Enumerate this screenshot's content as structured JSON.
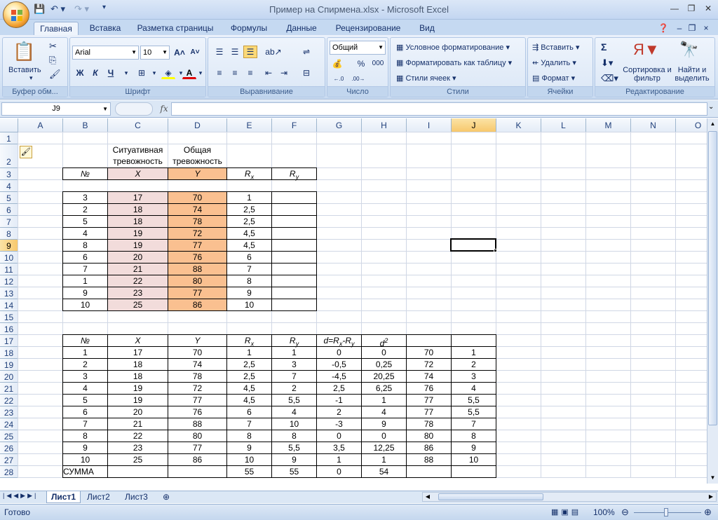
{
  "window": {
    "title": "Пример на Спирмена.xlsx - Microsoft Excel"
  },
  "ribbon": {
    "tabs": [
      "Главная",
      "Вставка",
      "Разметка страницы",
      "Формулы",
      "Данные",
      "Рецензирование",
      "Вид"
    ],
    "clipboard": {
      "paste": "Вставить",
      "label": "Буфер обм..."
    },
    "font": {
      "name": "Arial",
      "size": "10",
      "bold": "Ж",
      "italic": "К",
      "underline": "Ч",
      "label": "Шрифт"
    },
    "align": {
      "label": "Выравнивание"
    },
    "number": {
      "format": "Общий",
      "percent": "%",
      "thousands": "000",
      "label": "Число"
    },
    "styles": {
      "cond": "Условное форматирование",
      "table": "Форматировать как таблицу",
      "cell": "Стили ячеек",
      "label": "Стили"
    },
    "cells": {
      "insert": "Вставить",
      "delete": "Удалить",
      "format": "Формат",
      "label": "Ячейки"
    },
    "edit": {
      "sum": "Σ",
      "sort": "Сортировка и фильтр",
      "find": "Найти и выделить",
      "label": "Редактирование"
    }
  },
  "formula_bar": {
    "name_box": "J9",
    "fx": "fx",
    "value": ""
  },
  "grid": {
    "columns": [
      "A",
      "B",
      "C",
      "D",
      "E",
      "F",
      "G",
      "H",
      "I",
      "J",
      "K",
      "L",
      "M",
      "N",
      "O"
    ],
    "selected_col": "J",
    "selected_row": "9",
    "rows": [
      "1",
      "2",
      "3",
      "4",
      "5",
      "6",
      "7",
      "8",
      "9",
      "10",
      "11",
      "12",
      "13",
      "14",
      "15",
      "16",
      "17",
      "18",
      "19",
      "20",
      "21",
      "22",
      "23",
      "24",
      "25",
      "26",
      "27",
      "28"
    ]
  },
  "table1": {
    "header_c": "Ситуативная тревожность",
    "header_d": "Общая тревожность",
    "col_labels": {
      "b": "№",
      "c": "X",
      "d": "Y",
      "e": "R",
      "e_sub": "x",
      "f": "R",
      "f_sub": "y"
    },
    "rows": [
      [
        "3",
        "17",
        "70",
        "1"
      ],
      [
        "2",
        "18",
        "74",
        "2,5"
      ],
      [
        "5",
        "18",
        "78",
        "2,5"
      ],
      [
        "4",
        "19",
        "72",
        "4,5"
      ],
      [
        "8",
        "19",
        "77",
        "4,5"
      ],
      [
        "6",
        "20",
        "76",
        "6"
      ],
      [
        "7",
        "21",
        "88",
        "7"
      ],
      [
        "1",
        "22",
        "80",
        "8"
      ],
      [
        "9",
        "23",
        "77",
        "9"
      ],
      [
        "10",
        "25",
        "86",
        "10"
      ]
    ]
  },
  "table2": {
    "headers": {
      "b": "№",
      "c": "X",
      "d": "Y",
      "e": "R",
      "e_sub": "x",
      "f": "R",
      "f_sub": "y",
      "g1": "d=R",
      "g_sub1": "x",
      "g2": "-R",
      "g_sub2": "y",
      "h": "d",
      "h_sup": "2"
    },
    "rows": [
      [
        "1",
        "17",
        "70",
        "1",
        "1",
        "0",
        "0",
        "70",
        "1"
      ],
      [
        "2",
        "18",
        "74",
        "2,5",
        "3",
        "-0,5",
        "0,25",
        "72",
        "2"
      ],
      [
        "3",
        "18",
        "78",
        "2,5",
        "7",
        "-4,5",
        "20,25",
        "74",
        "3"
      ],
      [
        "4",
        "19",
        "72",
        "4,5",
        "2",
        "2,5",
        "6,25",
        "76",
        "4"
      ],
      [
        "5",
        "19",
        "77",
        "4,5",
        "5,5",
        "-1",
        "1",
        "77",
        "5,5"
      ],
      [
        "6",
        "20",
        "76",
        "6",
        "4",
        "2",
        "4",
        "77",
        "5,5"
      ],
      [
        "7",
        "21",
        "88",
        "7",
        "10",
        "-3",
        "9",
        "78",
        "7"
      ],
      [
        "8",
        "22",
        "80",
        "8",
        "8",
        "0",
        "0",
        "80",
        "8"
      ],
      [
        "9",
        "23",
        "77",
        "9",
        "5,5",
        "3,5",
        "12,25",
        "86",
        "9"
      ],
      [
        "10",
        "25",
        "86",
        "10",
        "9",
        "1",
        "1",
        "88",
        "10"
      ]
    ],
    "sum_row": [
      "СУММА",
      "",
      "",
      "55",
      "55",
      "0",
      "54",
      "",
      ""
    ]
  },
  "sheets": {
    "tabs": [
      "Лист1",
      "Лист2",
      "Лист3"
    ],
    "active": "Лист1"
  },
  "status": {
    "ready": "Готово",
    "zoom": "100%"
  }
}
